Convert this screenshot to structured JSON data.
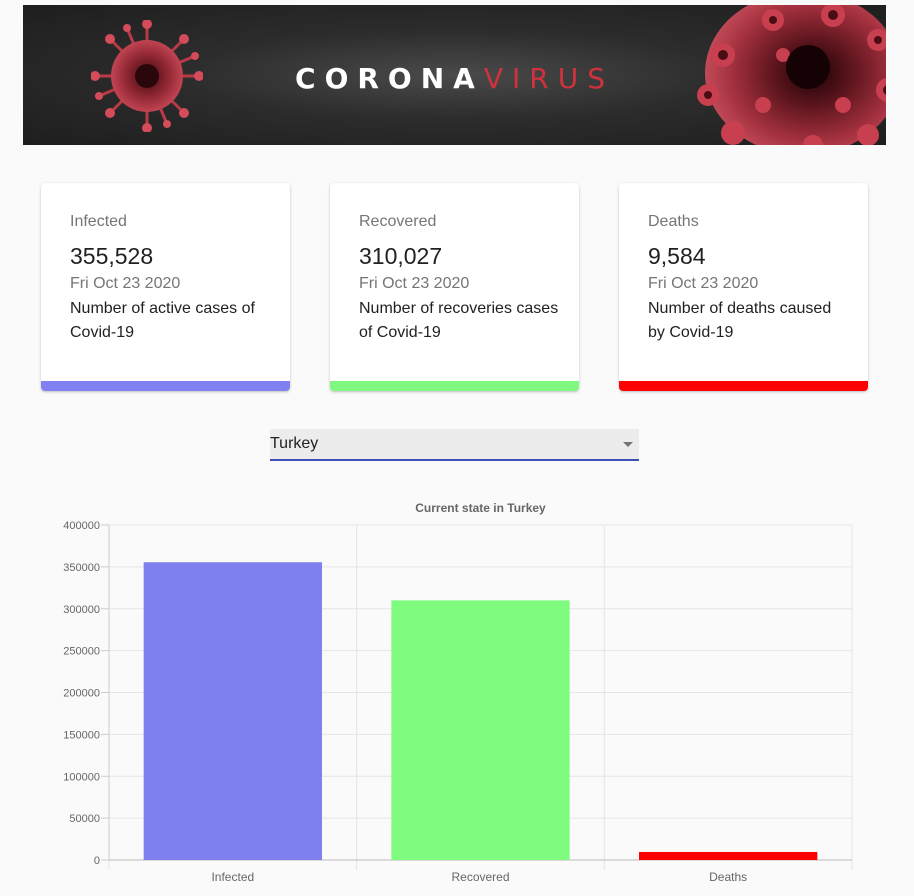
{
  "banner": {
    "title_part1": "CORONA",
    "title_part2": "VIRUS"
  },
  "cards": [
    {
      "label": "Infected",
      "value": "355,528",
      "date": "Fri Oct 23 2020",
      "description": "Number of active cases of Covid-19",
      "color": "#8080f0"
    },
    {
      "label": "Recovered",
      "value": "310,027",
      "date": "Fri Oct 23 2020",
      "description": "Number of recoveries cases of Covid-19",
      "color": "#80f880"
    },
    {
      "label": "Deaths",
      "value": "9,584",
      "date": "Fri Oct 23 2020",
      "description": "Number of deaths caused by Covid-19",
      "color": "#ff0000"
    }
  ],
  "country_select": {
    "selected": "Turkey"
  },
  "chart_data": {
    "type": "bar",
    "title": "Current state in Turkey",
    "categories": [
      "Infected",
      "Recovered",
      "Deaths"
    ],
    "values": [
      355528,
      310027,
      9584
    ],
    "colors": [
      "#7f7ff0",
      "#7ffc7f",
      "#ff0000"
    ],
    "ylim": [
      0,
      400000
    ],
    "yticks": [
      0,
      50000,
      100000,
      150000,
      200000,
      250000,
      300000,
      350000,
      400000
    ],
    "xlabel": "",
    "ylabel": "",
    "grid": true,
    "legend": "none"
  }
}
